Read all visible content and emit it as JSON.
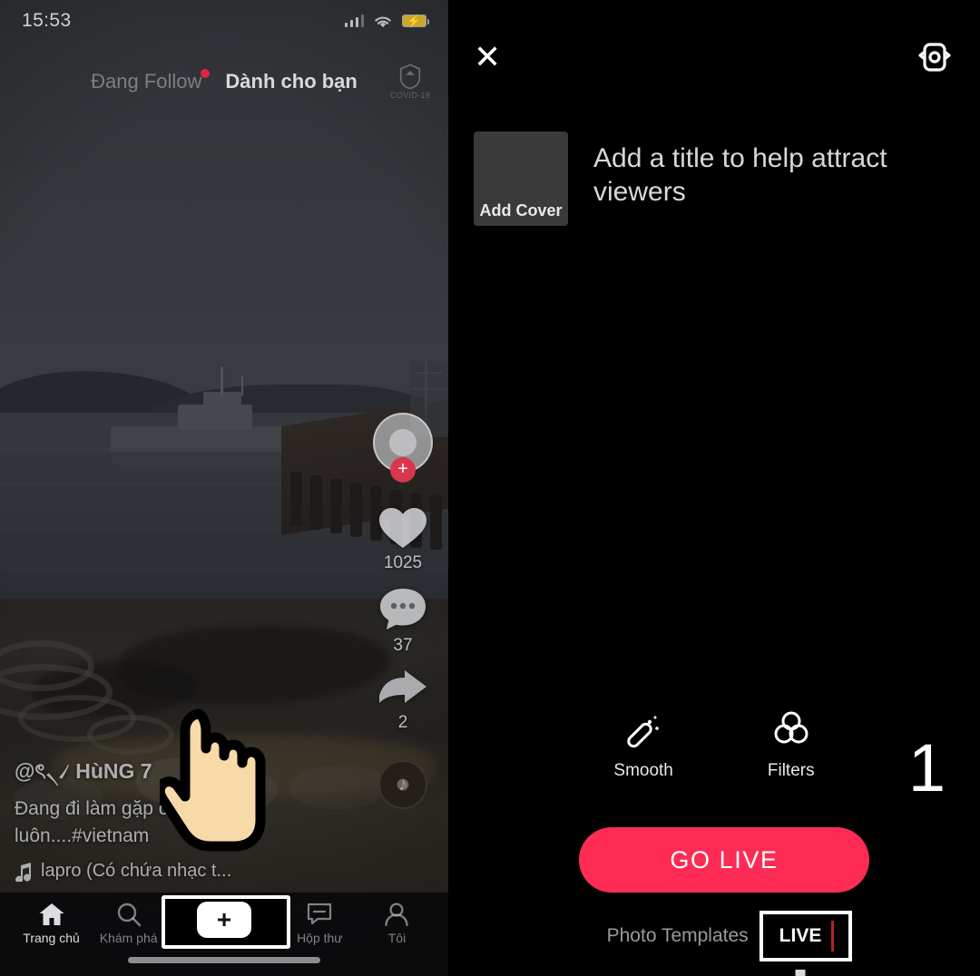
{
  "feed": {
    "status_bar": {
      "time": "15:53",
      "signal_icon": "cellular-signal-icon",
      "wifi_icon": "wifi-icon",
      "battery_icon": "battery-charging-icon"
    },
    "top_tabs": [
      {
        "label": "Đang Follow",
        "active": false,
        "badge": true
      },
      {
        "label": "Dành cho bạn",
        "active": true,
        "badge": false
      }
    ],
    "covid_button": {
      "label": "COVID-19",
      "icon": "shield-icon"
    },
    "actions": {
      "avatar": {
        "icon": "avatar",
        "follow_badge": "+"
      },
      "like": {
        "icon": "heart-icon",
        "count": "1025"
      },
      "comment": {
        "icon": "comment-icon",
        "count": "37"
      },
      "share": {
        "icon": "share-arrow-icon",
        "count": "2"
      },
      "music_disc": {
        "icon": "music-disc-icon",
        "note": "♪"
      }
    },
    "caption": {
      "username": "@ৎ৲৴ HùNG 7",
      "description": "Đang đi làm gặp các\nluôn....#vietnam",
      "music_icon": "music-note-icon",
      "music_text": "lapro (Có chứa nhạc t..."
    },
    "bottom_nav": [
      {
        "label": "Trang chủ",
        "icon": "home-icon",
        "active": true
      },
      {
        "label": "Khám phá",
        "icon": "search-icon",
        "active": false
      },
      {
        "label": "",
        "icon": "plus-create-icon",
        "active": false,
        "highlighted": true
      },
      {
        "label": "Hộp thư",
        "icon": "inbox-icon",
        "active": false
      },
      {
        "label": "Tôi",
        "icon": "person-icon",
        "active": false
      }
    ],
    "plus_glyph": "+"
  },
  "live": {
    "close_label": "✕",
    "flip_camera_icon": "camera-flip-icon",
    "cover": {
      "label": "Add Cover"
    },
    "title_placeholder": "Add a title to help attract viewers",
    "tools": [
      {
        "label": "Smooth",
        "icon": "magic-wand-icon"
      },
      {
        "label": "Filters",
        "icon": "filters-circles-icon"
      }
    ],
    "go_live_label": "GO LIVE",
    "modes": [
      {
        "label": "Photo Templates",
        "selected": false
      },
      {
        "label": "LIVE",
        "selected": true
      }
    ],
    "step_number": "1"
  },
  "colors": {
    "accent_pink": "#fe2c55",
    "follow_badge": "#d9354f",
    "live_dot": "#e0263f",
    "hand_skin": "#f8d9a8",
    "panel_bg": "#000000"
  }
}
